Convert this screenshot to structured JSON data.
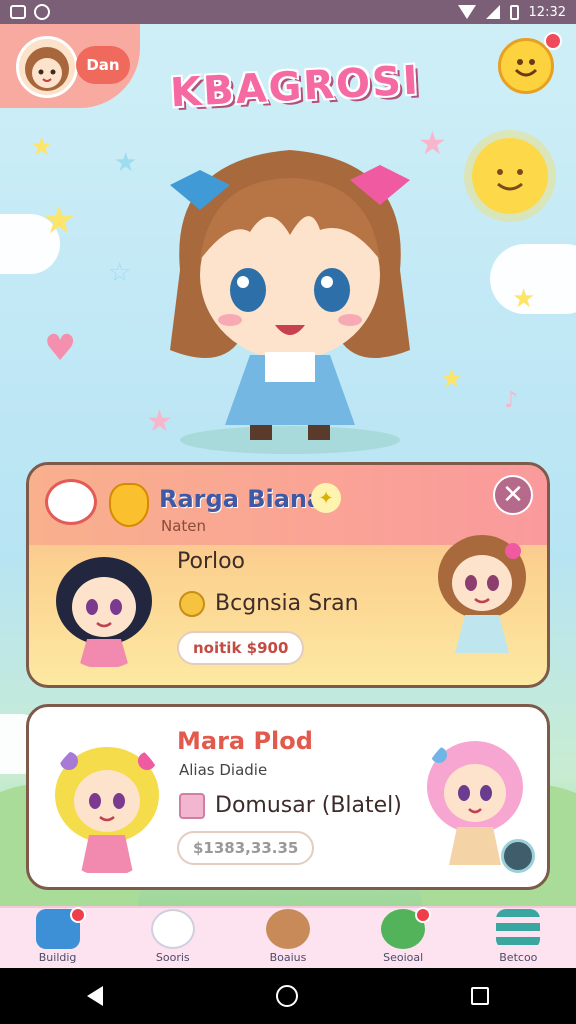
{
  "status_bar": {
    "time": "12:32"
  },
  "header": {
    "user_badge": "Dan",
    "app_title": "KBAGROSI"
  },
  "featured_card": {
    "title": "Rarga Biana",
    "subtitle": "Naten",
    "label": "Porloo",
    "item_name": "Bcgnsia Sran",
    "price": "noitik $900"
  },
  "second_card": {
    "title": "Mara Plod",
    "subtitle": "Alias Diadie",
    "item_name": "Domusar (Blatel)",
    "price": "$1383,33.35"
  },
  "bottom_nav": {
    "items": [
      {
        "label": "Buildig",
        "icon": "home-icon"
      },
      {
        "label": "Sooris",
        "icon": "bunny-icon"
      },
      {
        "label": "Boaius",
        "icon": "bear-icon"
      },
      {
        "label": "Seoioal",
        "icon": "chat-icon"
      },
      {
        "label": "Betcoo",
        "icon": "menu-icon"
      }
    ]
  },
  "colors": {
    "accent_pink": "#f56aa3",
    "card_title_blue": "#3e5aa6",
    "nav_bg": "#fde3ef"
  }
}
